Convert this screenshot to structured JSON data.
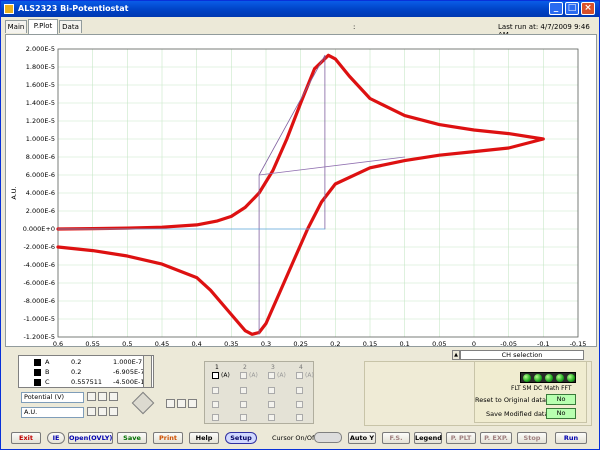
{
  "window": {
    "title": "ALS2323 Bi-Potentiostat",
    "minimize": "_",
    "maximize": "□",
    "close": "×"
  },
  "tabs": [
    {
      "label": "Main"
    },
    {
      "label": "P.Plot"
    },
    {
      "label": "Data"
    }
  ],
  "header": {
    "colon": ":",
    "last_run": "Last run at: 4/7/2009     9:46 AM"
  },
  "chart_data": {
    "type": "line",
    "xlabel": "Potential (V)",
    "ylabel": "A.U.",
    "xlim": [
      0.6,
      -0.15
    ],
    "ylim": [
      -1.2e-05,
      2e-05
    ],
    "x_ticks": [
      "0.6",
      "0.55",
      "0.5",
      "0.45",
      "0.4",
      "0.35",
      "0.3",
      "0.25",
      "0.2",
      "0.15",
      "0.1",
      "0.05",
      "0",
      "-0.05",
      "-0.1",
      "-0.15"
    ],
    "y_ticks": [
      "2.000E-5",
      "1.800E-5",
      "1.600E-5",
      "1.400E-5",
      "1.200E-5",
      "1.000E-5",
      "8.000E-6",
      "6.000E-6",
      "4.000E-6",
      "2.000E-6",
      "0.000E+0",
      "-2.000E-6",
      "-4.000E-6",
      "-6.000E-6",
      "-8.000E-6",
      "-1.000E-5",
      "-1.200E-5"
    ],
    "grid": true,
    "series": [
      {
        "color": "#dd1111",
        "x": [
          0.6,
          0.55,
          0.5,
          0.45,
          0.4,
          0.37,
          0.35,
          0.33,
          0.31,
          0.29,
          0.27,
          0.25,
          0.23,
          0.21,
          0.2,
          0.18,
          0.15,
          0.1,
          0.05,
          0.0,
          -0.05,
          -0.1,
          -0.05,
          0.0,
          0.05,
          0.1,
          0.15,
          0.2,
          0.22,
          0.24,
          0.26,
          0.28,
          0.3,
          0.31,
          0.32,
          0.33,
          0.35,
          0.38,
          0.4,
          0.45,
          0.5,
          0.55,
          0.6
        ],
        "y": [
          0.0,
          5e-08,
          1e-07,
          2e-07,
          4.5e-07,
          9e-07,
          1.4e-06,
          2.4e-06,
          4e-06,
          6.5e-06,
          1e-05,
          1.4e-05,
          1.78e-05,
          1.93e-05,
          1.89e-05,
          1.7e-05,
          1.45e-05,
          1.26e-05,
          1.16e-05,
          1.1e-05,
          1.06e-05,
          1e-05,
          9e-06,
          8.6e-06,
          8.2e-06,
          7.6e-06,
          6.8e-06,
          5e-06,
          3e-06,
          0.0,
          -3.5e-06,
          -7e-06,
          -1.05e-05,
          -1.15e-05,
          -1.17e-05,
          -1.13e-05,
          -9.5e-06,
          -6.8e-06,
          -5.4e-06,
          -3.9e-06,
          -3e-06,
          -2.4e-06,
          -2e-06
        ]
      },
      {
        "color": "#8060a0",
        "x": [
          0.31,
          0.31,
          0.215,
          0.215
        ],
        "y": [
          -1.17e-05,
          6e-06,
          1.93e-05,
          0.0
        ]
      },
      {
        "color": "#9070b0",
        "x": [
          0.31,
          0.1
        ],
        "y": [
          6e-06,
          8e-06
        ]
      },
      {
        "color": "#60a8e0",
        "x": [
          0.6,
          0.215
        ],
        "y": [
          0.0,
          0.0
        ]
      }
    ]
  },
  "legend": {
    "rows": [
      {
        "name": "A",
        "v1": "0.2",
        "v2": "1.000E-7"
      },
      {
        "name": "B",
        "v1": "0.2",
        "v2": "-6.905E-7"
      },
      {
        "name": "C",
        "v1": "0.557511",
        "v2": "-4.500E-11"
      }
    ]
  },
  "axis_selects": {
    "x": "Potential (V)",
    "y": "A.U."
  },
  "channels": {
    "headers": [
      "1",
      "2",
      "3",
      "4"
    ],
    "label": "(A)"
  },
  "ch_selection": "CH selection",
  "leds_label": "FLT SM DC Math FFT",
  "reset_label": "Reset to Original data?",
  "reset_value": "No",
  "save_label": "Save Modified data?",
  "save_value": "No",
  "toolbar": {
    "exit": "Exit",
    "ie": "IE",
    "open": "Open(OVLY)",
    "save": "Save",
    "print": "Print",
    "help": "Help",
    "setup": "Setup",
    "cursor": "Cursor On/Off",
    "autoy": "Auto Y",
    "fs": "F.S.",
    "legend": "Legend",
    "pplt": "P. PLT",
    "pexp": "P. EXP.",
    "stop": "Stop",
    "run": "Run"
  }
}
